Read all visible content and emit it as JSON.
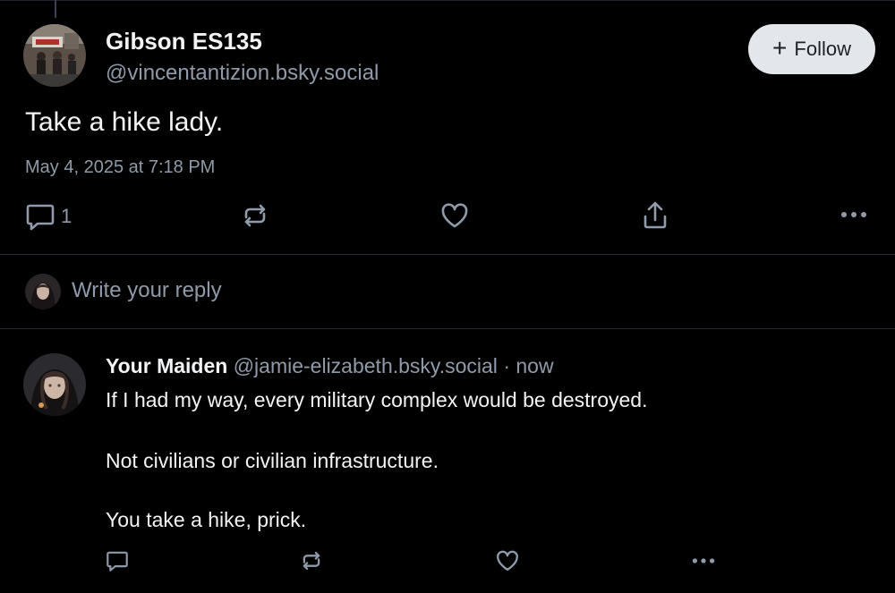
{
  "post": {
    "author_name": "Gibson ES135",
    "author_handle": "@vincentantizion.bsky.social",
    "follow_label": "Follow",
    "text": "Take a hike lady.",
    "timestamp": "May 4, 2025 at 7:18 PM",
    "reply_count": "1"
  },
  "compose": {
    "placeholder": "Write your reply"
  },
  "reply": {
    "author_name": "Your Maiden",
    "author_handle": "@jamie-elizabeth.bsky.social",
    "separator": "·",
    "time": "now",
    "lines": [
      "If I had my way, every military complex would be destroyed.",
      "Not civilians or civilian infrastructure.",
      "You take a hike, prick."
    ]
  },
  "icons": {
    "reply": "speech-bubble-icon",
    "repost": "repost-arrows-icon",
    "like": "heart-icon",
    "share": "share-upload-icon",
    "more": "more-dots-icon"
  },
  "colors": {
    "background": "#000000",
    "text": "#f1f3f5",
    "muted": "#8f9baa",
    "follow_bg": "#e3e7ec"
  }
}
